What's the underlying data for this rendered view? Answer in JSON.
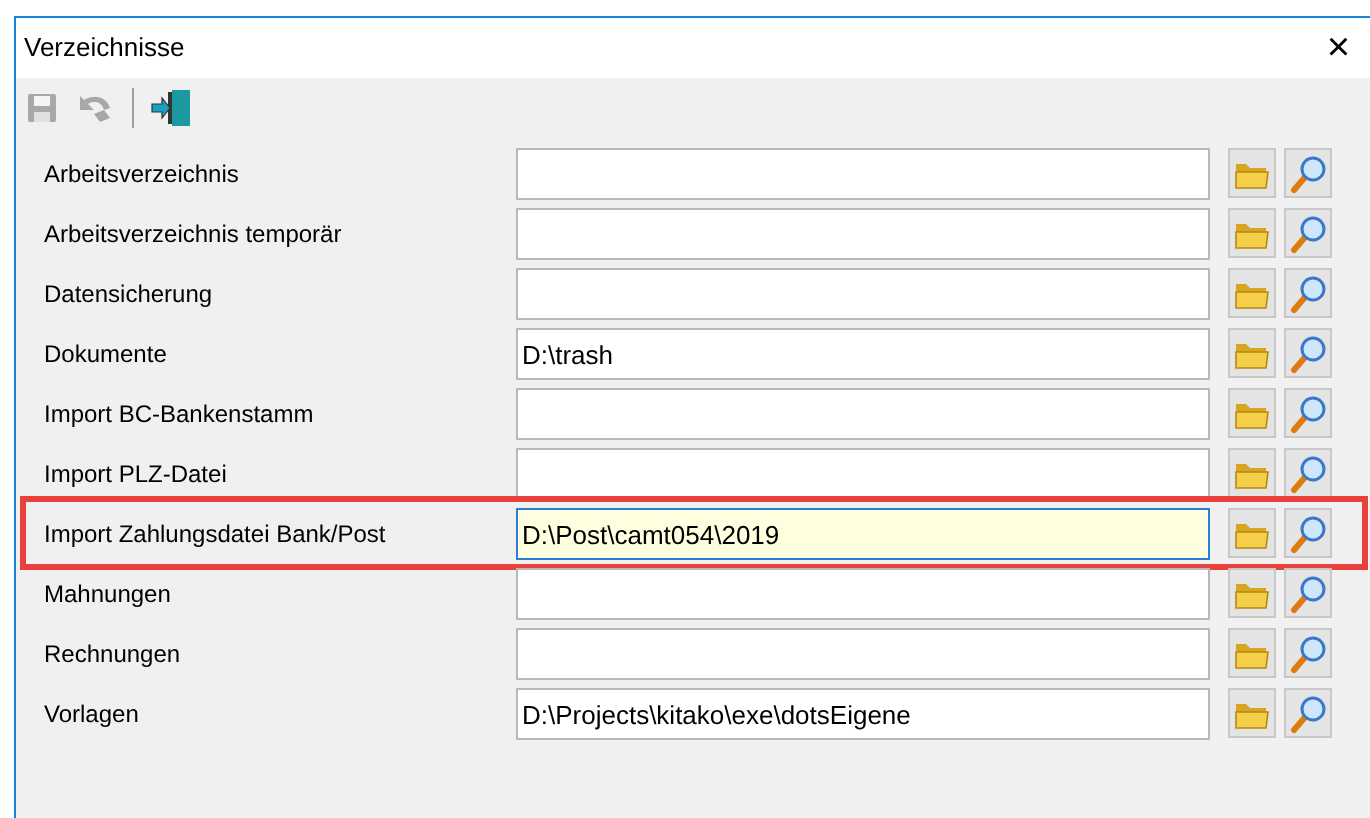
{
  "window": {
    "title": "Verzeichnisse",
    "close": "×"
  },
  "toolbar": [
    {
      "kind": "save",
      "disabled": true
    },
    {
      "kind": "undo",
      "disabled": true
    },
    {
      "kind": "separator"
    },
    {
      "kind": "exit",
      "disabled": false
    }
  ],
  "rows": [
    {
      "label": "Arbeitsverzeichnis",
      "value": "",
      "focused": false,
      "highlighted": false
    },
    {
      "label": "Arbeitsverzeichnis temporär",
      "value": "",
      "focused": false,
      "highlighted": false
    },
    {
      "label": "Datensicherung",
      "value": "",
      "focused": false,
      "highlighted": false
    },
    {
      "label": "Dokumente",
      "value": "D:\\trash",
      "focused": false,
      "highlighted": false
    },
    {
      "label": "Import BC-Bankenstamm",
      "value": "",
      "focused": false,
      "highlighted": false
    },
    {
      "label": "Import PLZ-Datei",
      "value": "",
      "focused": false,
      "highlighted": false
    },
    {
      "label": "Import Zahlungsdatei Bank/Post",
      "value": "D:\\Post\\camt054\\2019",
      "focused": true,
      "highlighted": true
    },
    {
      "label": "Mahnungen",
      "value": "",
      "focused": false,
      "highlighted": false
    },
    {
      "label": "Rechnungen",
      "value": "",
      "focused": false,
      "highlighted": false
    },
    {
      "label": "Vorlagen",
      "value": "D:\\Projects\\kitako\\exe\\dotsEigene",
      "focused": false,
      "highlighted": false
    }
  ]
}
